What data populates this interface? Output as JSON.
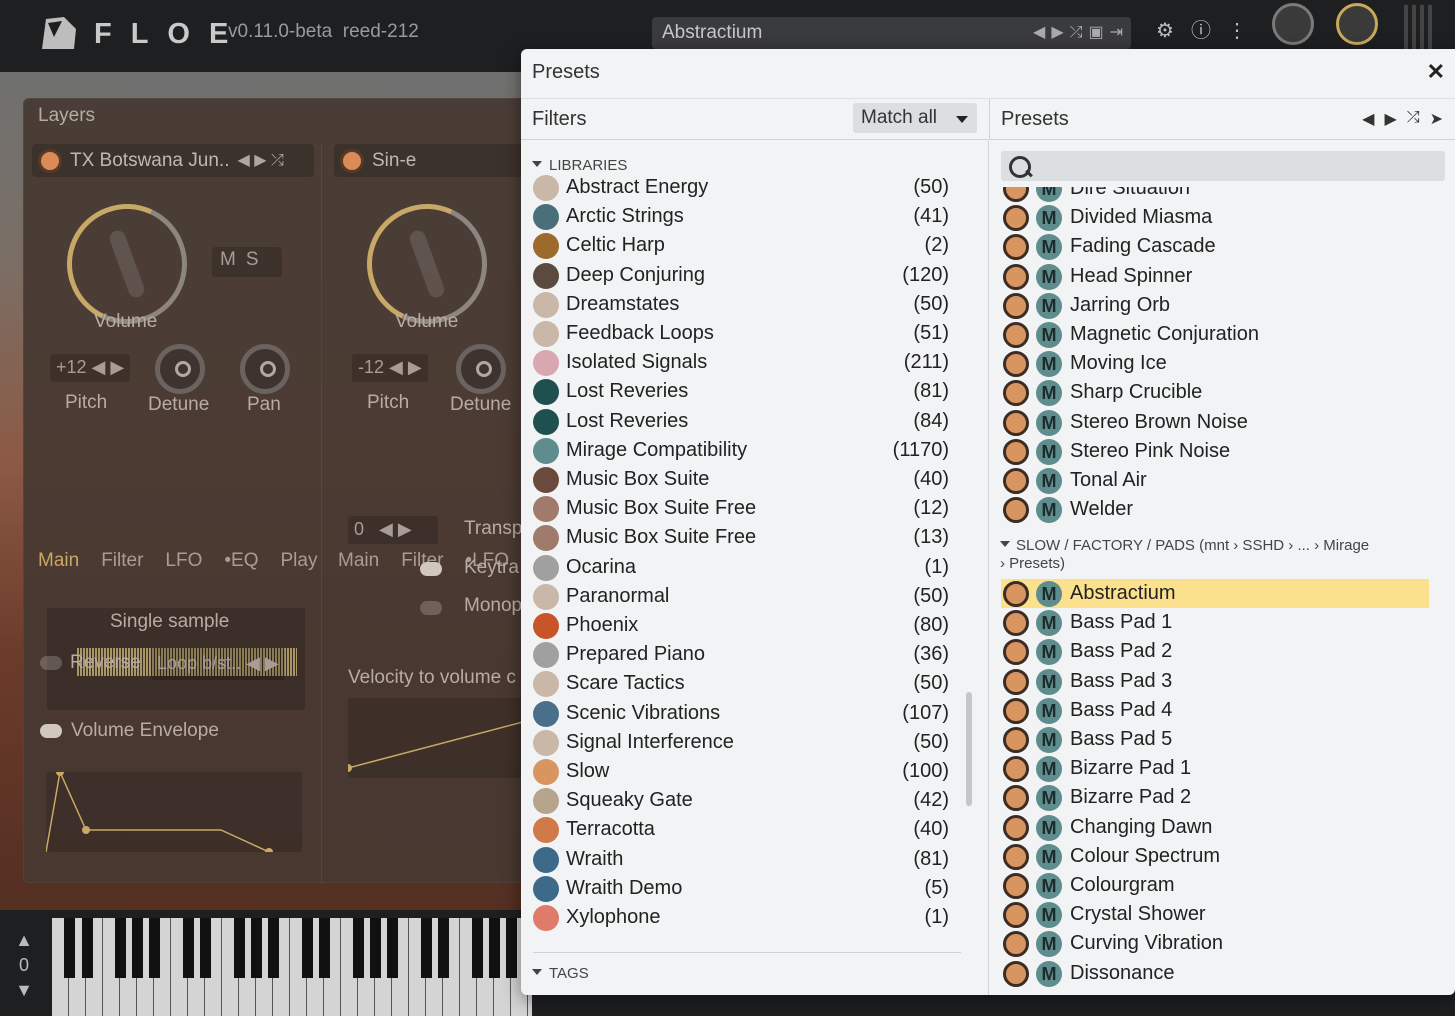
{
  "topbar": {
    "brand": "FLOE",
    "version": "v0.11.0-beta  reed-212",
    "current_preset": "Abstractium"
  },
  "layers": {
    "title": "Layers",
    "layer1": {
      "instrument": "TX Botswana Jun..",
      "volume_label": "Volume",
      "mute_label": "M",
      "solo_label": "S",
      "pitch_value": "+12",
      "pitch_label": "Pitch",
      "detune_label": "Detune",
      "pan_label": "Pan",
      "tabs": [
        "Main",
        "Filter",
        "LFO",
        "•EQ",
        "Play"
      ],
      "sample_mode": "Single sample",
      "reverse_label": "Reverse",
      "loop_mode": "Loop b/st..",
      "envelope_label": "Volume Envelope"
    },
    "layer2": {
      "instrument": "Sin-e",
      "volume_label": "Volume",
      "pitch_value": "-12",
      "pitch_label": "Pitch",
      "detune_label": "Detune",
      "tabs": [
        "Main",
        "Filter",
        "•LFO"
      ],
      "transpose_value": "0",
      "transpose_label": "Transp",
      "keytrack_label": "Keytra",
      "mono_label": "Monop",
      "velocity_label": "Velocity to volume c"
    }
  },
  "keyboard": {
    "octave": "0"
  },
  "modal": {
    "title": "Presets",
    "filters_title": "Filters",
    "match_label": "Match all",
    "presets_title": "Presets",
    "libraries_heading": "LIBRARIES",
    "tags_heading": "TAGS",
    "libraries": [
      {
        "name": "Abstract Energy",
        "count": "(50)",
        "color": "#c9b7a8"
      },
      {
        "name": "Arctic Strings",
        "count": "(41)",
        "color": "#4a6f7a"
      },
      {
        "name": "Celtic Harp",
        "count": "(2)",
        "color": "#9b6a2c"
      },
      {
        "name": "Deep Conjuring",
        "count": "(120)",
        "color": "#5a4a40"
      },
      {
        "name": "Dreamstates",
        "count": "(50)",
        "color": "#c9b7a8"
      },
      {
        "name": "Feedback Loops",
        "count": "(51)",
        "color": "#c9b7a8"
      },
      {
        "name": "Isolated Signals",
        "count": "(211)",
        "color": "#d8a7b0"
      },
      {
        "name": "Lost Reveries",
        "count": "(81)",
        "color": "#1f4f4f"
      },
      {
        "name": "Lost Reveries",
        "count": "(84)",
        "color": "#1f4f4f"
      },
      {
        "name": "Mirage Compatibility",
        "count": "(1170)",
        "color": "#5f8c8c"
      },
      {
        "name": "Music Box Suite",
        "count": "(40)",
        "color": "#6a4a3c"
      },
      {
        "name": "Music Box Suite Free",
        "count": "(12)",
        "color": "#a07a6a"
      },
      {
        "name": "Music Box Suite Free",
        "count": "(13)",
        "color": "#a07a6a"
      },
      {
        "name": "Ocarina",
        "count": "(1)",
        "color": "#a0a0a0"
      },
      {
        "name": "Paranormal",
        "count": "(50)",
        "color": "#c9b7a8"
      },
      {
        "name": "Phoenix",
        "count": "(80)",
        "color": "#c8542a"
      },
      {
        "name": "Prepared Piano",
        "count": "(36)",
        "color": "#a0a0a0"
      },
      {
        "name": "Scare Tactics",
        "count": "(50)",
        "color": "#c9b7a8"
      },
      {
        "name": "Scenic Vibrations",
        "count": "(107)",
        "color": "#4a6f8a"
      },
      {
        "name": "Signal Interference",
        "count": "(50)",
        "color": "#c9b7a8"
      },
      {
        "name": "Slow",
        "count": "(100)",
        "color": "#d99560"
      },
      {
        "name": "Squeaky Gate",
        "count": "(42)",
        "color": "#b7a48c"
      },
      {
        "name": "Terracotta",
        "count": "(40)",
        "color": "#d07a4a"
      },
      {
        "name": "Wraith",
        "count": "(81)",
        "color": "#3e6a8a"
      },
      {
        "name": "Wraith Demo",
        "count": "(5)",
        "color": "#3e6a8a"
      },
      {
        "name": "Xylophone",
        "count": "(1)",
        "color": "#e07a6a"
      }
    ],
    "search_placeholder": "",
    "presets_top": [
      "Dire Situation",
      "Divided Miasma",
      "Fading Cascade",
      "Head Spinner",
      "Jarring Orb",
      "Magnetic Conjuration",
      "Moving Ice",
      "Sharp Crucible",
      "Stereo Brown Noise",
      "Stereo Pink Noise",
      "Tonal Air",
      "Welder"
    ],
    "folder_path": "SLOW / FACTORY / PADS (mnt › SSHD › ... › Mirage › Presets)",
    "presets_folder": [
      "Abstractium",
      "Bass Pad 1",
      "Bass Pad 2",
      "Bass Pad 3",
      "Bass Pad 4",
      "Bass Pad 5",
      "Bizarre Pad 1",
      "Bizarre Pad 2",
      "Changing Dawn",
      "Colour Spectrum",
      "Colourgram",
      "Crystal Shower",
      "Curving Vibration",
      "Dissonance"
    ],
    "selected_preset": "Abstractium",
    "preset_badge": "M",
    "highlight_color": "#fbe18d"
  }
}
